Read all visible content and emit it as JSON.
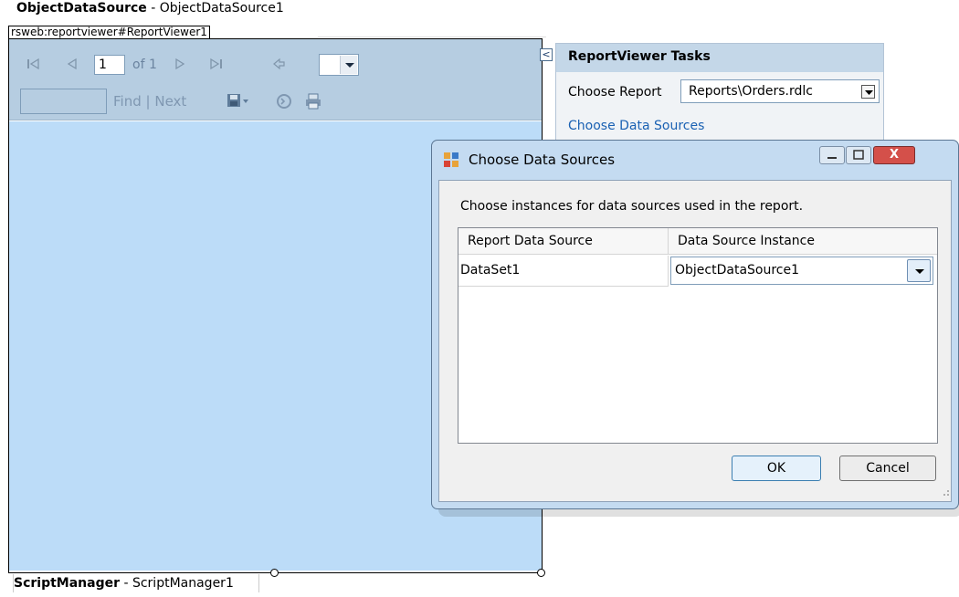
{
  "designer": {
    "objectdatasource_bold": "ObjectDataSource",
    "objectdatasource_rest": " - ObjectDataSource1",
    "reportviewer_tag": "rsweb:reportviewer#ReportViewer1",
    "scriptmanager_bold": "ScriptManager",
    "scriptmanager_rest": " - ScriptManager1"
  },
  "toolbar": {
    "first_icon": "first-page-icon",
    "prev_icon": "previous-page-icon",
    "page_number": "1",
    "of_label": "of 1",
    "next_icon": "next-page-icon",
    "last_icon": "last-page-icon",
    "back_icon": "back-to-parent-icon",
    "zoom_value": "",
    "find_value": "",
    "find_label": "Find",
    "separator": "|",
    "next_label": "Next",
    "export_icon": "export-save-icon",
    "refresh_icon": "refresh-icon",
    "print_icon": "print-icon"
  },
  "tasks": {
    "collapse_glyph": "<",
    "header": "ReportViewer Tasks",
    "choose_report_label": "Choose Report",
    "report_value": "Reports\\Orders.rdlc",
    "choose_data_sources_link": "Choose Data Sources"
  },
  "dialog": {
    "title": "Choose Data Sources",
    "instructions": "Choose instances for data sources used in the report.",
    "columns": [
      "Report Data Source",
      "Data Source Instance"
    ],
    "rows": [
      {
        "report_data_source": "DataSet1",
        "instance": "ObjectDataSource1"
      }
    ],
    "ok_label": "OK",
    "cancel_label": "Cancel",
    "close_glyph": "X"
  },
  "colors": {
    "toolbar_bg": "#b6cde1",
    "viewer_bg": "#bcdcf8",
    "dialog_frame": "#c4dbf1",
    "link": "#1a61b3",
    "close_button": "#d4504a"
  }
}
